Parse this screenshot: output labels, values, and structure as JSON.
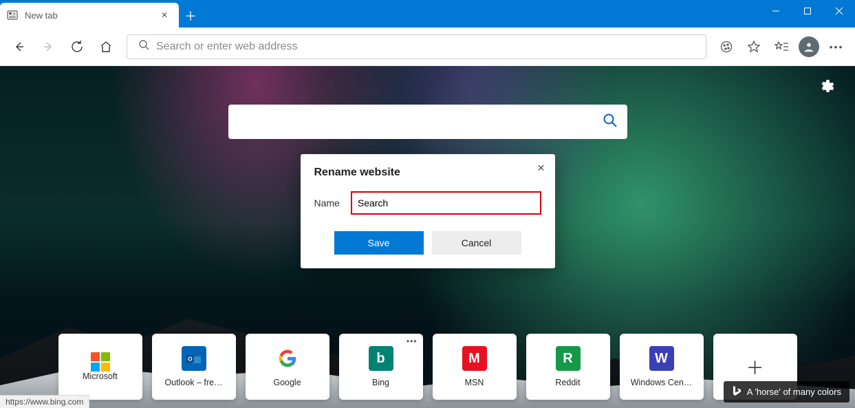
{
  "titlebar": {
    "tab_label": "New tab"
  },
  "toolbar": {
    "address_placeholder": "Search or enter web address"
  },
  "dialog": {
    "title": "Rename website",
    "name_label": "Name",
    "name_value": "Search",
    "save_label": "Save",
    "cancel_label": "Cancel"
  },
  "tiles": [
    {
      "label": "Microsoft",
      "icon": "microsoft-grid",
      "bg": "transparent",
      "letter": ""
    },
    {
      "label": "Outlook – fre…",
      "icon": "outlook",
      "bg": "#0364b8",
      "letter": ""
    },
    {
      "label": "Google",
      "icon": "google-g",
      "bg": "#ffffff",
      "letter": "G"
    },
    {
      "label": "Bing",
      "icon": "bing",
      "bg": "#008373",
      "letter": "b",
      "showMore": true
    },
    {
      "label": "MSN",
      "icon": "msn",
      "bg": "#e81123",
      "letter": "M"
    },
    {
      "label": "Reddit",
      "icon": "reddit",
      "bg": "#159947",
      "letter": "R"
    },
    {
      "label": "Windows Cen…",
      "icon": "windows-central",
      "bg": "#3b3fb6",
      "letter": "W"
    }
  ],
  "caption": {
    "text": "A 'horse' of many colors"
  },
  "status": {
    "url": "https://www.bing.com"
  }
}
